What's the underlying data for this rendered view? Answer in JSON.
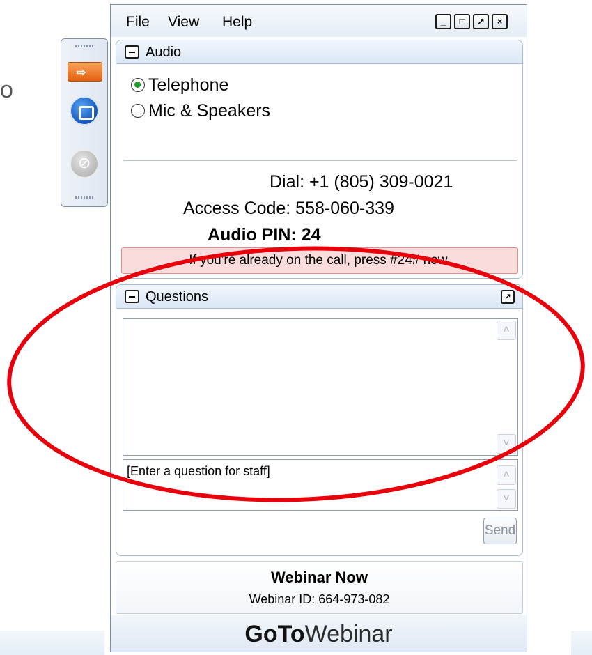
{
  "background": {
    "partial_letter": "o"
  },
  "control_panel": {
    "buttons": [
      {
        "name": "show-hide-arrow",
        "color": "#e4610f"
      },
      {
        "name": "screen-share",
        "color": "#1d5fc6"
      },
      {
        "name": "microphone-muted",
        "color": "#b9b9b9"
      }
    ]
  },
  "window": {
    "menu": [
      "File",
      "View",
      "Help"
    ],
    "controls": {
      "minimize": "_",
      "maximize": "□",
      "popout": "↗",
      "close": "×"
    }
  },
  "audio": {
    "title": "Audio",
    "options": [
      {
        "label": "Telephone",
        "selected": true
      },
      {
        "label": "Mic & Speakers",
        "selected": false
      }
    ],
    "dial": "Dial: +1 (805) 309-0021",
    "access_code": "Access Code: 558-060-339",
    "audio_pin": "Audio PIN: 24",
    "alert": "If you're already on the call, press #24# now."
  },
  "questions": {
    "title": "Questions",
    "input_placeholder": "[Enter a question for staff]",
    "send_label": "Send"
  },
  "webinar": {
    "name": "Webinar Now",
    "id_text": "Webinar ID: 664-973-082"
  },
  "branding": {
    "logo_bold": "GoTo",
    "logo_regular": "Webinar"
  },
  "colors": {
    "annotation": "#e8000b",
    "alert_bg": "#fadcdc",
    "radio_selected": "#1c9a2a"
  }
}
